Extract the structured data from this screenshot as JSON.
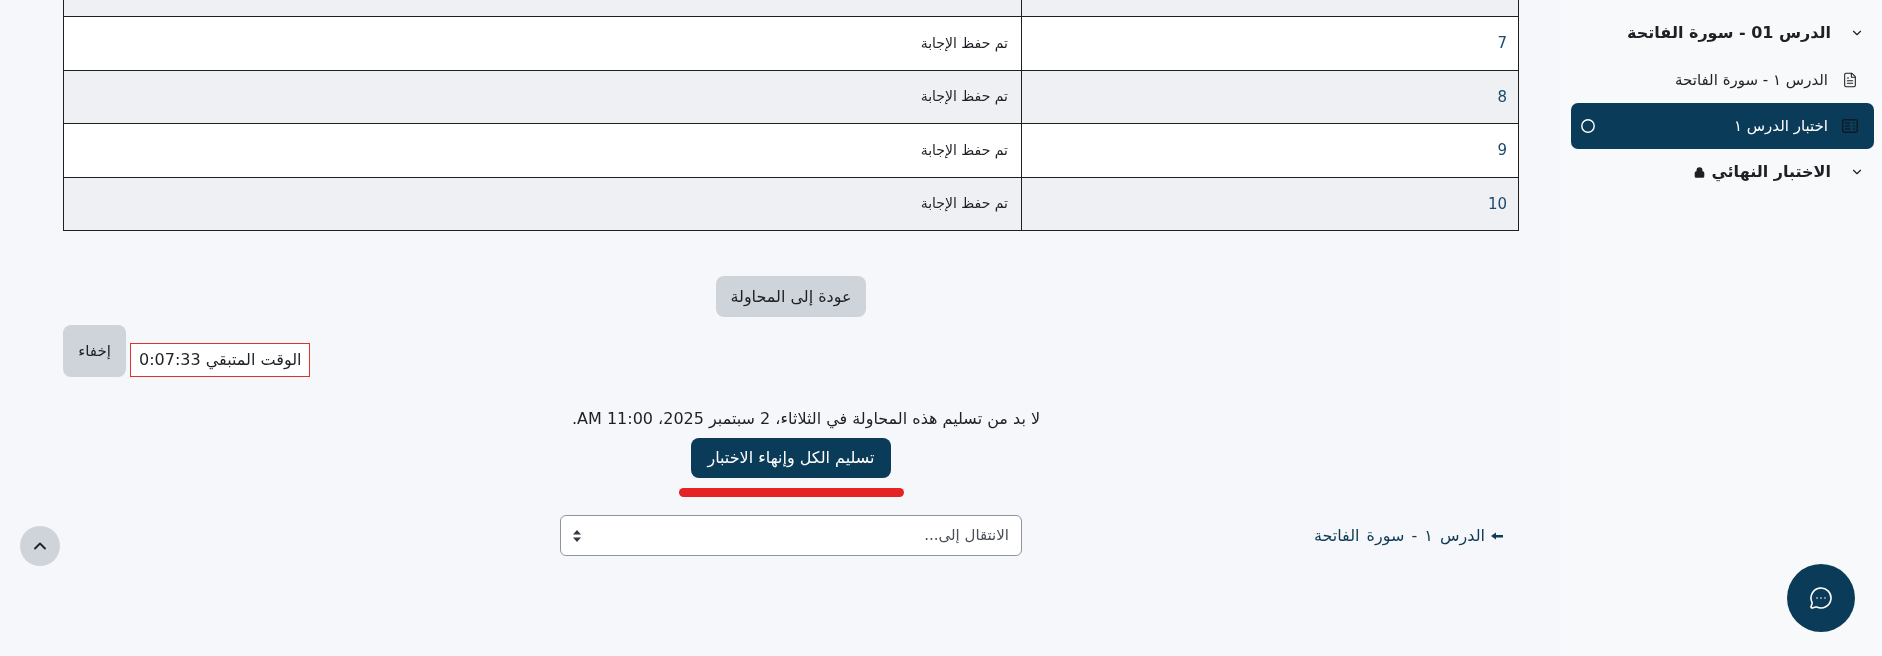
{
  "summary_table": {
    "rows": [
      {
        "question": "7",
        "status": "تم حفظ الإجابة"
      },
      {
        "question": "8",
        "status": "تم حفظ الإجابة"
      },
      {
        "question": "9",
        "status": "تم حفظ الإجابة"
      },
      {
        "question": "10",
        "status": "تم حفظ الإجابة"
      }
    ]
  },
  "back_button": "عودة إلى المحاولة",
  "timer": {
    "hide_button": "إخفاء",
    "text": "الوقت المتبقي 0:07:33"
  },
  "deadline_notice": "لا بد من تسليم هذه المحاولة في الثلاثاء، 2 سبتمبر 2025، 11:00 AM.",
  "submit_button": "تسليم الكل وإنهاء الاختبار",
  "navigation": {
    "previous_link": "الدرس ١ - سورة الفاتحة",
    "jump_select": {
      "value": "الانتقال إلى..."
    }
  },
  "sidebar": {
    "sections": [
      {
        "title": "الدرس 01 - سورة الفاتحة",
        "expanded": true,
        "items": [
          {
            "kind": "page",
            "label": "الدرس ١ - سورة الفاتحة",
            "selected": false
          },
          {
            "kind": "quiz",
            "label": "اختبار الدرس ١",
            "selected": true,
            "completed": false
          }
        ]
      },
      {
        "title": "الاختبار النهائي",
        "expanded": true,
        "locked": true
      }
    ]
  }
}
